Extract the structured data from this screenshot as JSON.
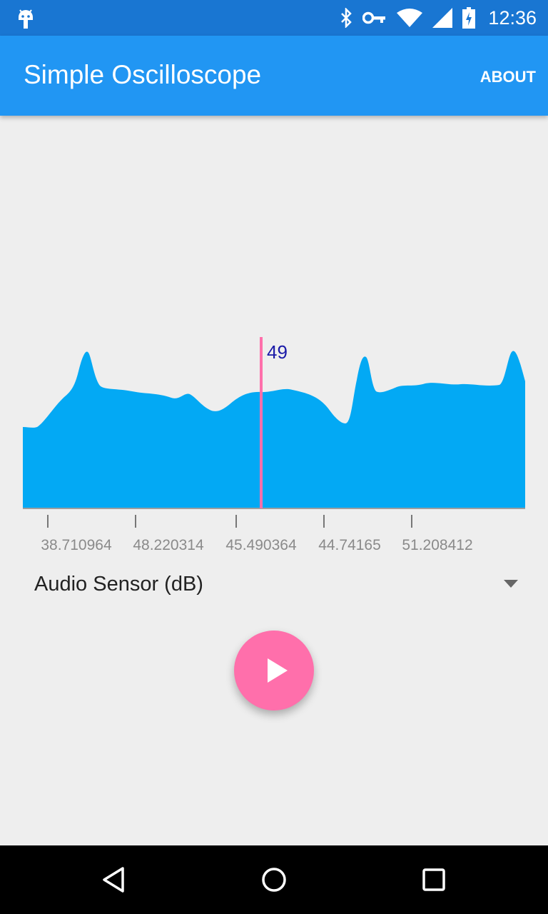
{
  "status_bar": {
    "time": "12:36",
    "icons": [
      "android-debug-icon",
      "bluetooth-icon",
      "vpn-key-icon",
      "wifi-icon",
      "signal-icon",
      "battery-charging-icon"
    ]
  },
  "app_bar": {
    "title": "Simple Oscilloscope",
    "about_label": "ABOUT"
  },
  "colors": {
    "status_bar": "#1976d2",
    "app_bar": "#2196f3",
    "waveform": "#03a9f4",
    "marker": "#ff6fab",
    "marker_label": "#1a1aa8",
    "fab": "#ff6fab",
    "background": "#eeeeee"
  },
  "chart_data": {
    "type": "area",
    "marker_value": "49",
    "x_tick_labels": [
      "38.710964",
      "48.220314",
      "45.490364",
      "44.74165",
      "51.208412"
    ]
  },
  "sensor_select": {
    "selected": "Audio Sensor (dB)"
  },
  "nav_bar": {
    "buttons": [
      "back-icon",
      "home-icon",
      "recents-icon"
    ]
  }
}
